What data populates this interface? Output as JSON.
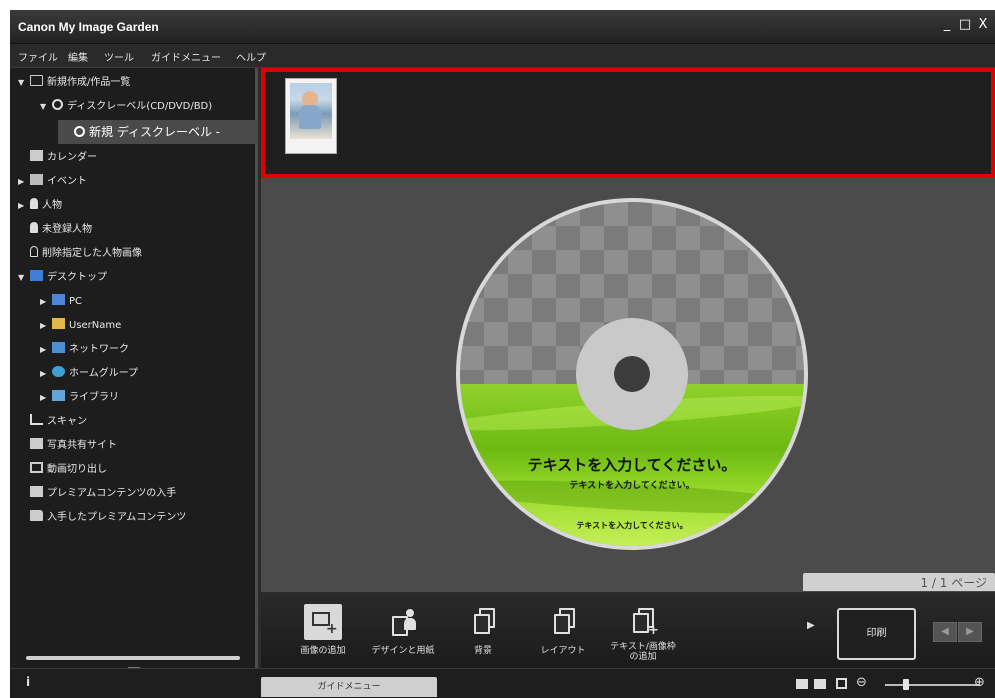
{
  "window": {
    "title": "Canon My Image Garden",
    "controls": [
      "_",
      "□",
      "X"
    ]
  },
  "menu": [
    "ファイル",
    "編集",
    "ツール",
    "ガイドメニュー",
    "ヘルプ"
  ],
  "sidebar": {
    "items": [
      {
        "label": "新規作成/作品一覧",
        "icon": "new-item-icon",
        "arrow": "▼"
      },
      {
        "label": "ディスクレーベル(CD/DVD/BD)",
        "icon": "disc-icon",
        "arrow": "▼"
      },
      {
        "label": "新規 ディスクレーベル -",
        "icon": "disc-icon",
        "arrow": "",
        "selected": true
      },
      {
        "label": "カレンダー",
        "icon": "calendar-icon",
        "arrow": ""
      },
      {
        "label": "イベント",
        "icon": "event-icon",
        "arrow": "▶"
      },
      {
        "label": "人物",
        "icon": "person-icon",
        "arrow": "▶"
      },
      {
        "label": "未登録人物",
        "icon": "person-icon",
        "arrow": ""
      },
      {
        "label": "削除指定した人物画像",
        "icon": "person-outline-icon",
        "arrow": ""
      },
      {
        "label": "デスクトップ",
        "icon": "desktop-icon",
        "arrow": "▼"
      },
      {
        "label": "PC",
        "icon": "pc-icon",
        "arrow": "▶"
      },
      {
        "label": "UserName",
        "icon": "user-folder-icon",
        "arrow": "▶"
      },
      {
        "label": "ネットワーク",
        "icon": "network-icon",
        "arrow": "▶"
      },
      {
        "label": "ホームグループ",
        "icon": "homegroup-icon",
        "arrow": "▶"
      },
      {
        "label": "ライブラリ",
        "icon": "library-icon",
        "arrow": "▶"
      },
      {
        "label": "スキャン",
        "icon": "scan-icon",
        "arrow": ""
      },
      {
        "label": "写真共有サイト",
        "icon": "photo-share-icon",
        "arrow": ""
      },
      {
        "label": "動画切り出し",
        "icon": "video-cut-icon",
        "arrow": ""
      },
      {
        "label": "プレミアムコンテンツの入手",
        "icon": "premium-download-icon",
        "arrow": ""
      },
      {
        "label": "入手したプレミアムコンテンツ",
        "icon": "folder-icon",
        "arrow": ""
      }
    ]
  },
  "disc": {
    "text_large": "テキストを入力してください。",
    "text_medium": "テキストを入力してください。",
    "text_small": "テキストを入力してください。"
  },
  "page_indicator": "1 / 1 ページ",
  "toolbar": {
    "add_image": "画像の追加",
    "design_paper": "デザインと用紙",
    "background": "背景",
    "layout": "レイアウト",
    "add_text_frame_line1": "テキスト/画像枠",
    "add_text_frame_line2": "の追加",
    "next": "▶",
    "print": "印刷",
    "prev_page": "◀",
    "next_page": "▶"
  },
  "statusbar": {
    "info": "i",
    "guide_menu": "ガイドメニュー",
    "zoom_out": "⊖",
    "zoom_in": "⊕"
  },
  "colors": {
    "highlight": "#e00000",
    "disc_green": "#7cc41d",
    "panel_dark": "#1d1d1d"
  }
}
